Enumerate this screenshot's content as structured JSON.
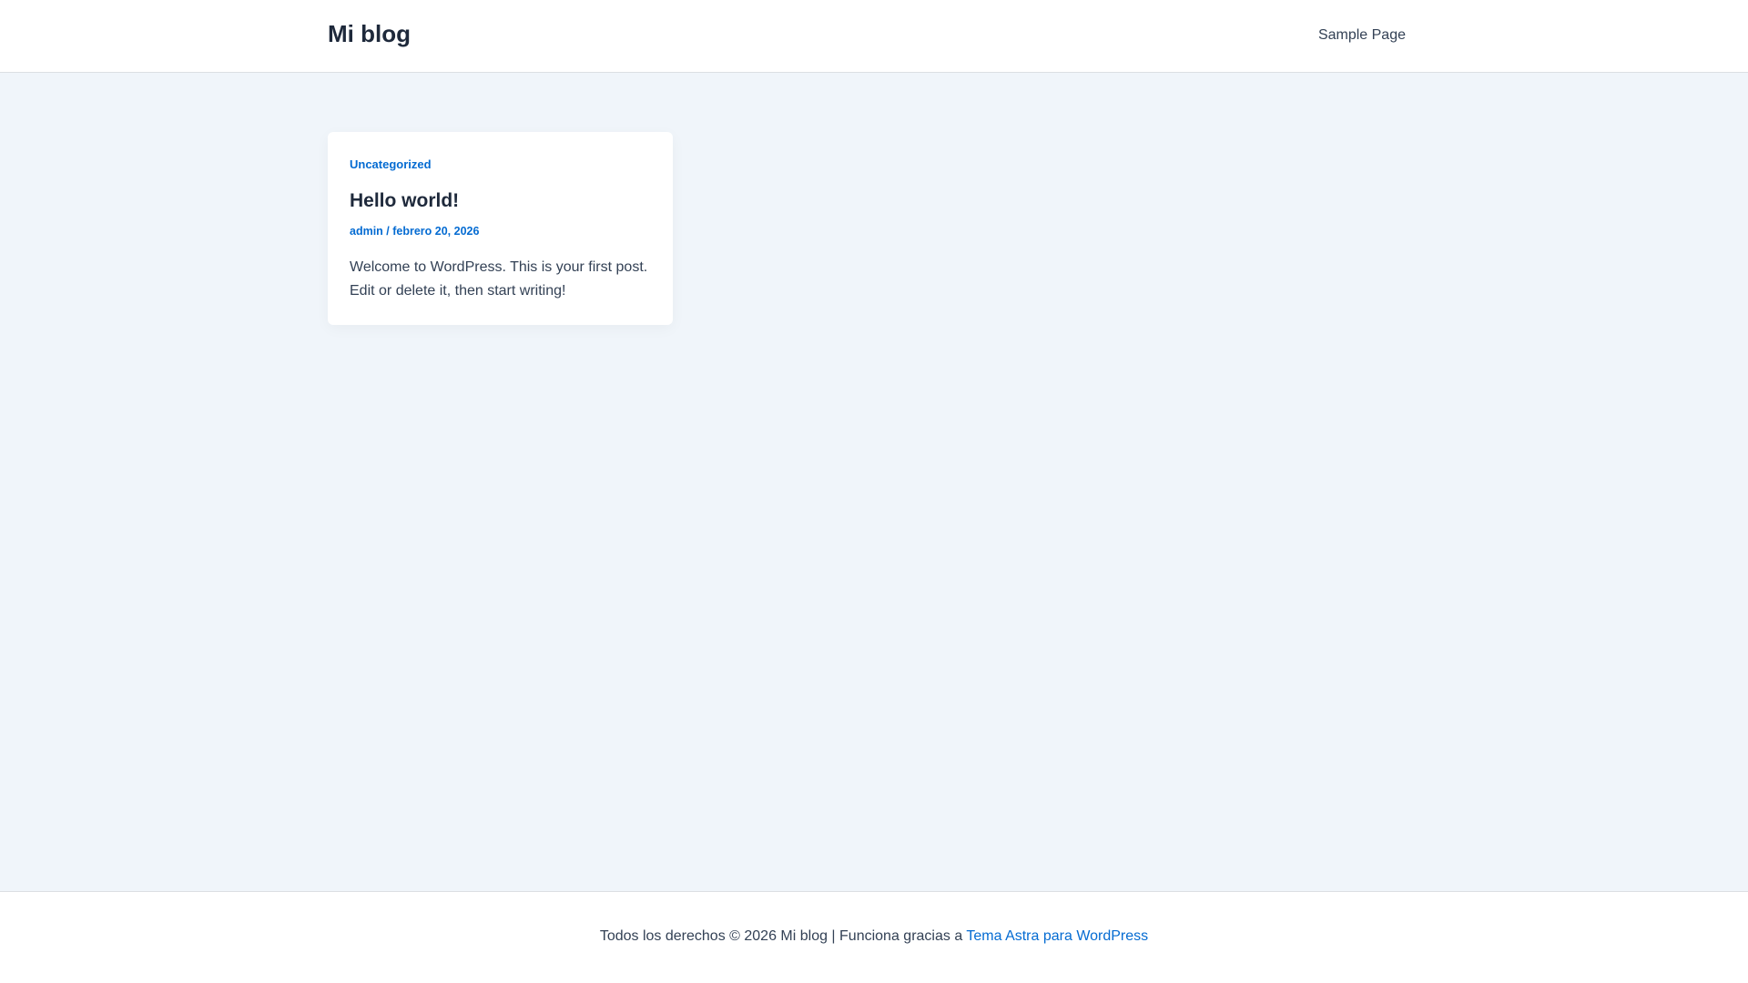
{
  "header": {
    "site_title": "Mi blog",
    "nav": [
      "Sample Page"
    ]
  },
  "post": {
    "category": "Uncategorized",
    "title": "Hello world!",
    "author": "admin",
    "separator": " / ",
    "date": "febrero 20, 2026",
    "excerpt": "Welcome to WordPress. This is your first post. Edit or delete it, then start writing!"
  },
  "footer": {
    "text": "Todos los derechos © 2026 Mi blog | Funciona gracias a ",
    "link": "Tema Astra para WordPress"
  },
  "colors": {
    "accent": "#046bd2",
    "background": "#f0f5fa",
    "heading": "#1e293b"
  }
}
